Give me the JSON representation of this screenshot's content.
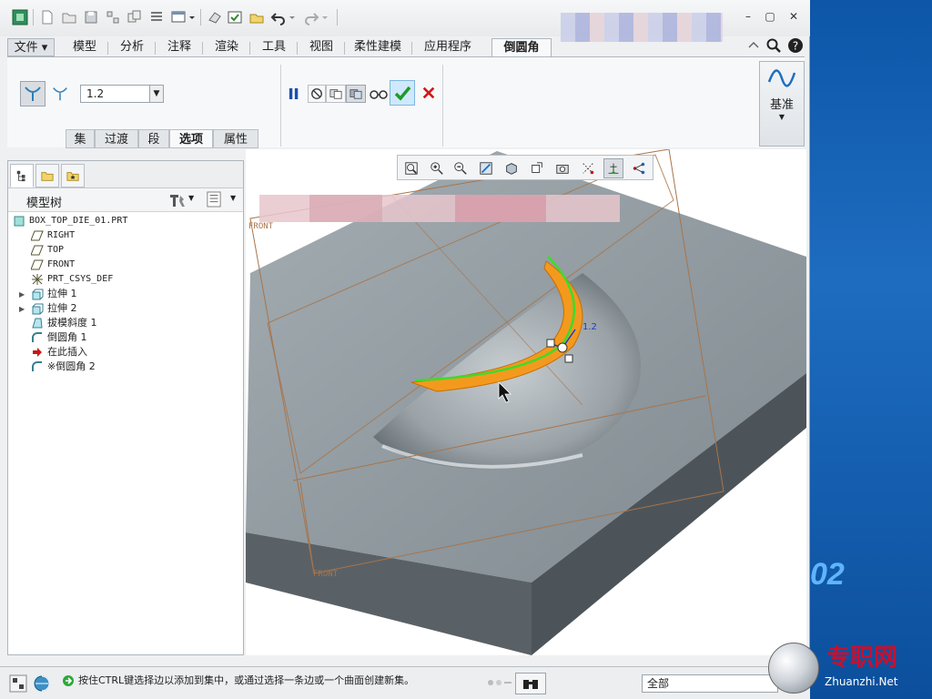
{
  "ribbon": {
    "tabs": [
      {
        "label": "文件 ▾"
      },
      {
        "label": "模型"
      },
      {
        "label": "分析"
      },
      {
        "label": "注释"
      },
      {
        "label": "渲染"
      },
      {
        "label": "工具"
      },
      {
        "label": "视图"
      },
      {
        "label": "柔性建模"
      },
      {
        "label": "应用程序"
      },
      {
        "label": "倒圆角"
      }
    ],
    "radius_value": "1.2",
    "subtabs": [
      "集",
      "过渡",
      "段",
      "选项",
      "属性"
    ],
    "datum_label": "基准"
  },
  "tree": {
    "title": "模型树",
    "items": [
      {
        "label": "BOX_TOP_DIE_01.PRT",
        "icon": "part-icon"
      },
      {
        "label": "RIGHT",
        "icon": "plane-icon"
      },
      {
        "label": "TOP",
        "icon": "plane-icon"
      },
      {
        "label": "FRONT",
        "icon": "plane-icon"
      },
      {
        "label": "PRT_CSYS_DEF",
        "icon": "csys-icon"
      },
      {
        "label": "拉伸 1",
        "icon": "extrude-icon"
      },
      {
        "label": "拉伸 2",
        "icon": "extrude-icon"
      },
      {
        "label": "拔模斜度 1",
        "icon": "draft-icon"
      },
      {
        "label": "倒圆角 1",
        "icon": "round-icon"
      },
      {
        "label": "在此插入",
        "icon": "insert-arrow-icon"
      },
      {
        "label": "※倒圆角 2",
        "icon": "round-icon"
      }
    ]
  },
  "viewport": {
    "plane_label_top": "FRONT",
    "plane_label_bottom": "FRONT",
    "dimension_label": "1.2"
  },
  "status": {
    "message": "按住CTRL键选择边以添加到集中，或通过选择一条边或一个曲面创建新集。",
    "filter_value": "全部"
  },
  "desktop": {
    "year_text": "02",
    "brand_cn": "专职网",
    "brand_url": "Zhuanzhi.Net"
  },
  "colors": {
    "accent_orange": "#f39a1e",
    "edge_green": "#3ddc2a",
    "model_gray": "#8f999f",
    "datum_brown": "#a8744a",
    "ok_green": "#1e9b2a",
    "cancel_red": "#d01818"
  }
}
